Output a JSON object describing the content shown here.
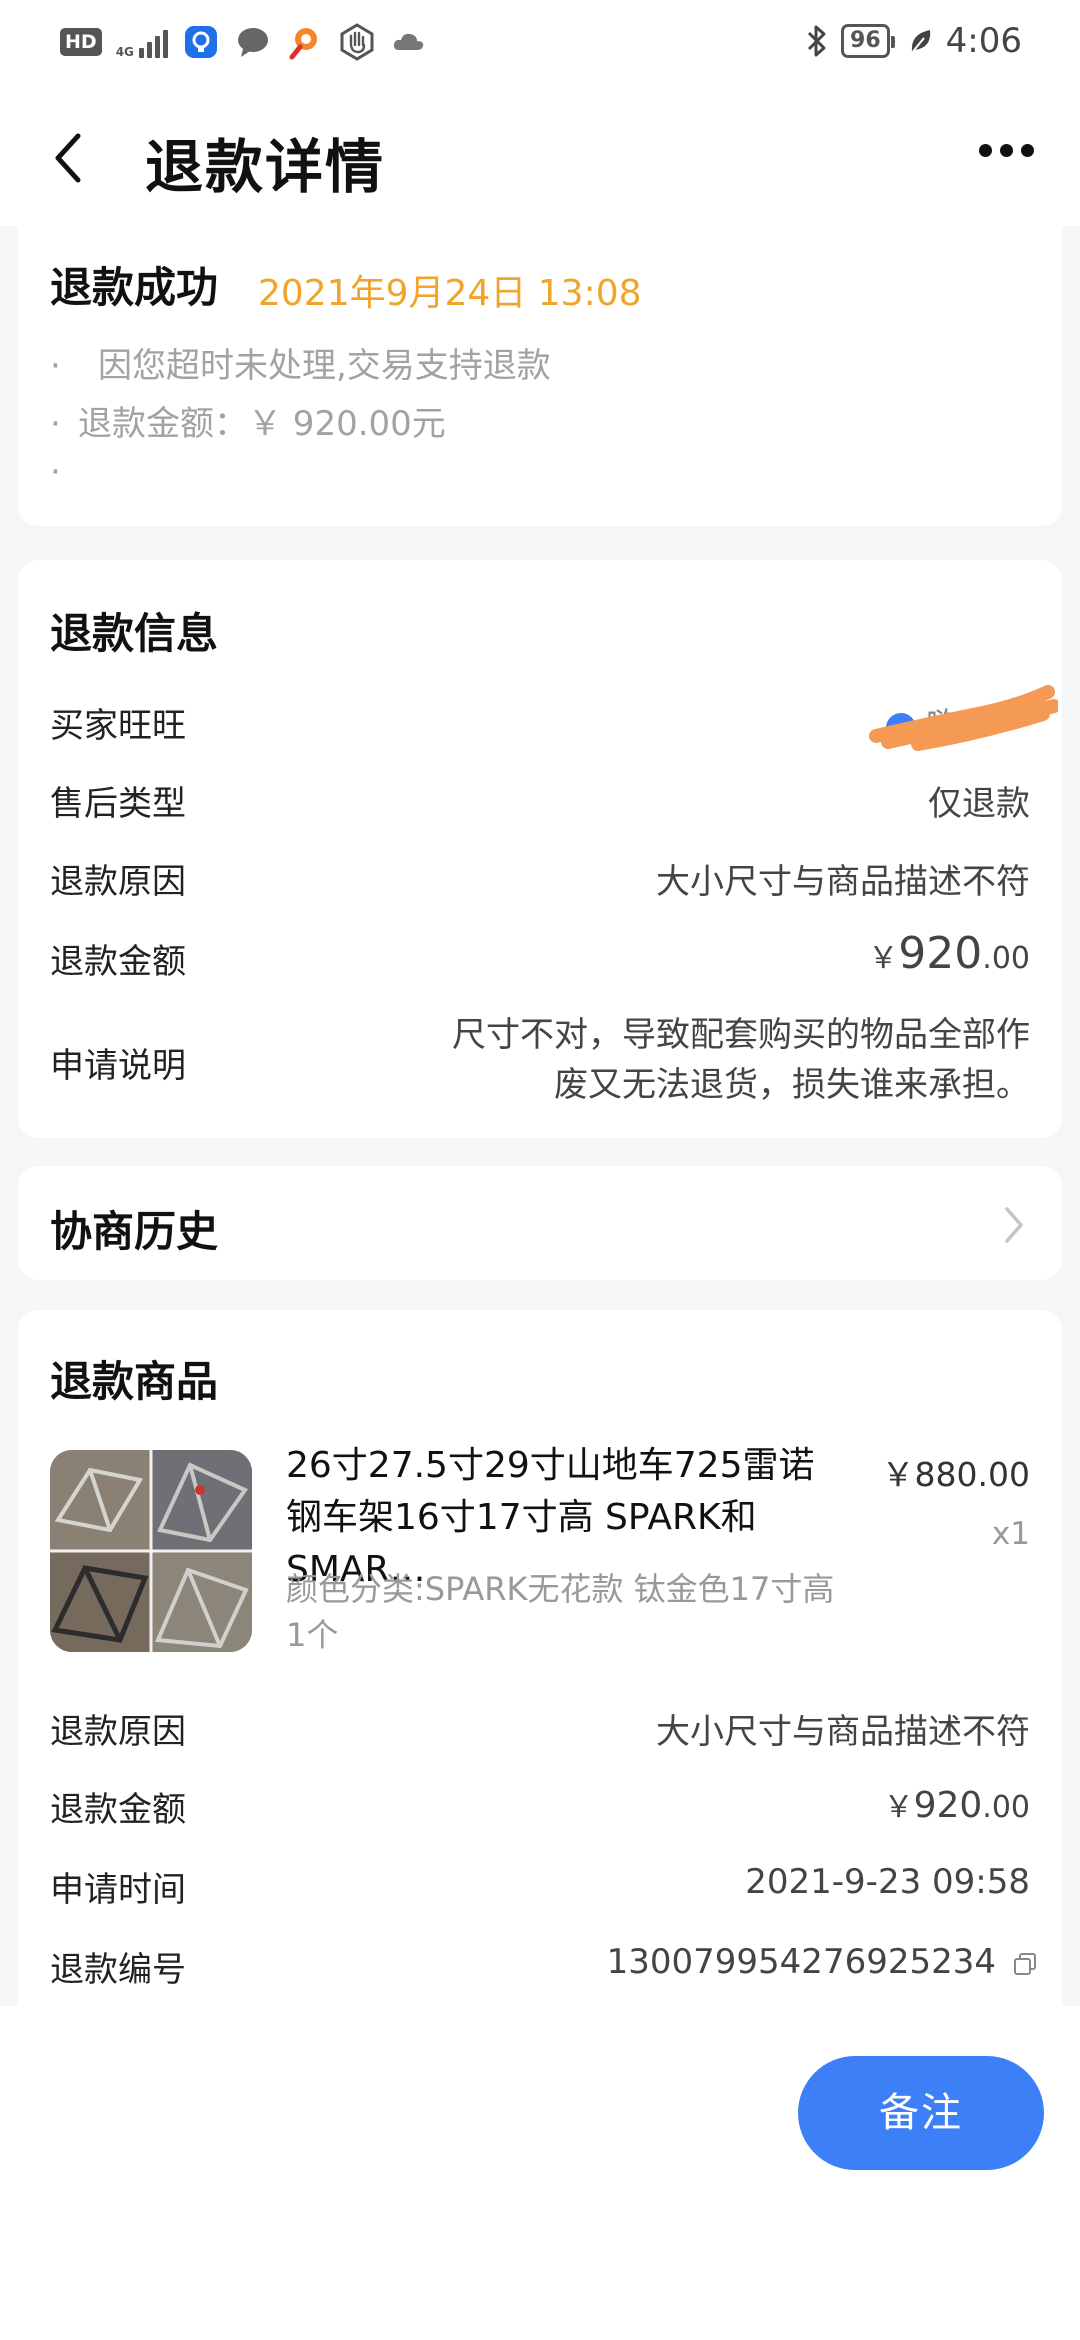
{
  "status_bar": {
    "hd": "HD",
    "network": "4G",
    "battery": "96",
    "time": "4:06"
  },
  "nav": {
    "title": "退款详情"
  },
  "status_card": {
    "title": "退款成功",
    "date": "2021年9月24日 13:08",
    "bullets": [
      "因您超时未处理,交易支持退款",
      "退款金额：￥ 920.00元",
      ""
    ]
  },
  "refund_info": {
    "title": "退款信息",
    "buyer_label": "买家旺旺",
    "buyer_value": "嗨",
    "type_label": "售后类型",
    "type_value": "仅退款",
    "reason_label": "退款原因",
    "reason_value": "大小尺寸与商品描述不符",
    "amount_label": "退款金额",
    "amount_symbol": "￥",
    "amount_int": "920",
    "amount_dec": ".00",
    "note_label": "申请说明",
    "note_line1": "尺寸不对，导致配套购买的物品全部作",
    "note_line2": "废又无法退货，损失谁来承担。"
  },
  "history": {
    "title": "协商历史"
  },
  "refund_goods": {
    "title": "退款商品",
    "product_title": "26寸27.5寸29寸山地车725雷诺钢车架16寸17寸高 SPARK和SMAR…",
    "price": "￥880.00",
    "qty": "x1",
    "spec": "颜色分类:SPARK无花款 钛金色17寸高 1个",
    "reason_label": "退款原因",
    "reason_value": "大小尺寸与商品描述不符",
    "amount_label": "退款金额",
    "amount_symbol": "￥",
    "amount_int": "920",
    "amount_dec": ".00",
    "time_label": "申请时间",
    "time_value": "2021-9-23 09:58",
    "no_label": "退款编号",
    "no_value": "1300799542769252​34"
  },
  "actions": {
    "remark": "备注"
  },
  "colors": {
    "accent": "#3d7ff6",
    "date_orange": "#f0a52a",
    "scribble": "#f49a55"
  }
}
